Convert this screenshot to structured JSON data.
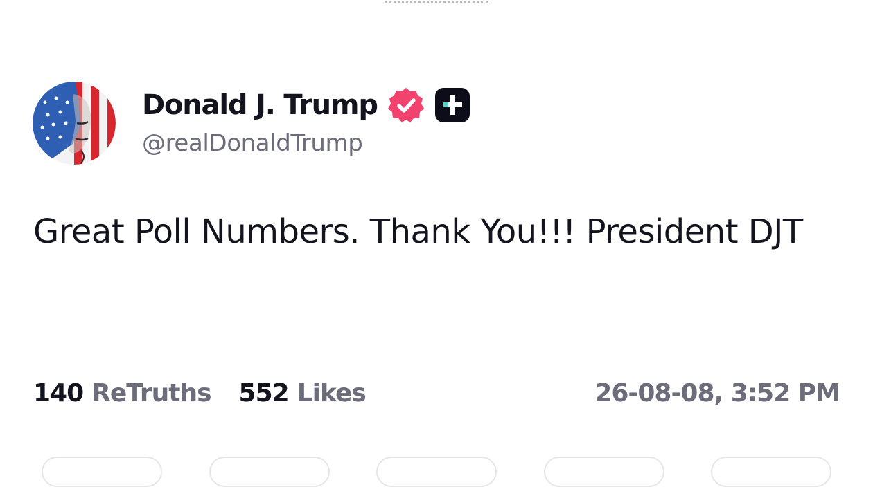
{
  "author": {
    "display_name": "Donald J. Trump",
    "handle": "@realDonaldTrump",
    "avatar_icon": "avatar-flag-portrait",
    "verified_icon": "verified-badge-icon",
    "verified_color": "#f2426e",
    "plus_icon": "truth-plus-icon",
    "plus_color": "#0d0d1a"
  },
  "post": {
    "text": "Great Poll Numbers. Thank You!!! President DJT"
  },
  "stats": {
    "retruths_count": "140",
    "retruths_label": "ReTruths",
    "likes_count": "552",
    "likes_label": "Likes",
    "timestamp": "26-08-08, 3:52 PM"
  }
}
